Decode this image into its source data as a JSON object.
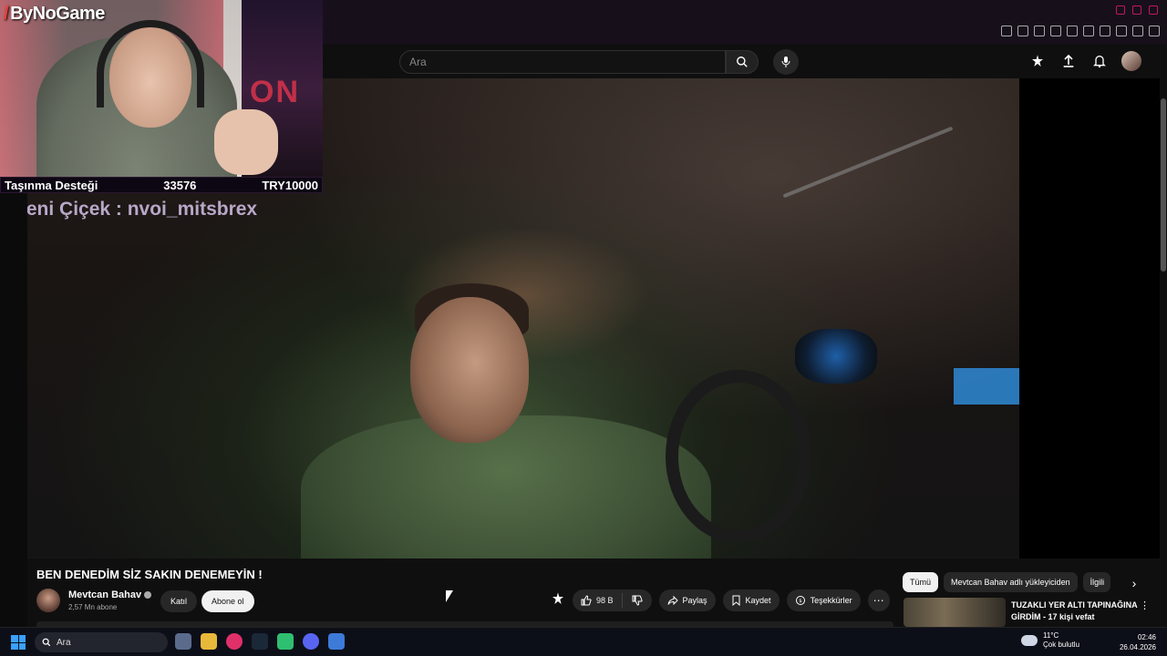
{
  "stream_overlay": {
    "logo": "ByNoGame",
    "donation_goal_label": "Taşınma Desteği",
    "donation_current": "33576",
    "donation_target": "TRY10000",
    "poster_text": "ON A",
    "ticker": "Yeni Çiçek : nvoi_mitsbrex"
  },
  "masthead": {
    "search_placeholder": "Ara",
    "icons": [
      "search-icon",
      "mic-icon",
      "create-icon",
      "upload-icon",
      "notifications-icon",
      "avatar"
    ]
  },
  "video": {
    "title": "BEN DENEDİM SİZ SAKIN DENEMEYİN !",
    "channel_name": "Mevtcan Bahav",
    "subscribers": "2,57 Mn abone",
    "join_label": "Katıl",
    "subscribe_label": "Abone ol",
    "likes": "98 B",
    "share_label": "Paylaş",
    "save_label": "Kaydet",
    "thanks_label": "Teşekkürler"
  },
  "chips": {
    "all": "Tümü",
    "from_uploader": "Mevtcan Bahav adlı yükleyiciden",
    "related": "İlgili"
  },
  "recommendation": {
    "title": "TUZAKLI YER ALTI TAPINAĞINA GİRDİM - 17 kişi vefat"
  },
  "taskbar": {
    "search_label": "Ara",
    "temperature": "11°C",
    "weather": "Çok bulutlu",
    "time": "02:46",
    "date": "26.04.2026"
  },
  "colors": {
    "accent_overlay": "#c2185b",
    "youtube_bg": "#0f0f0f",
    "pill_bg": "#272727"
  }
}
